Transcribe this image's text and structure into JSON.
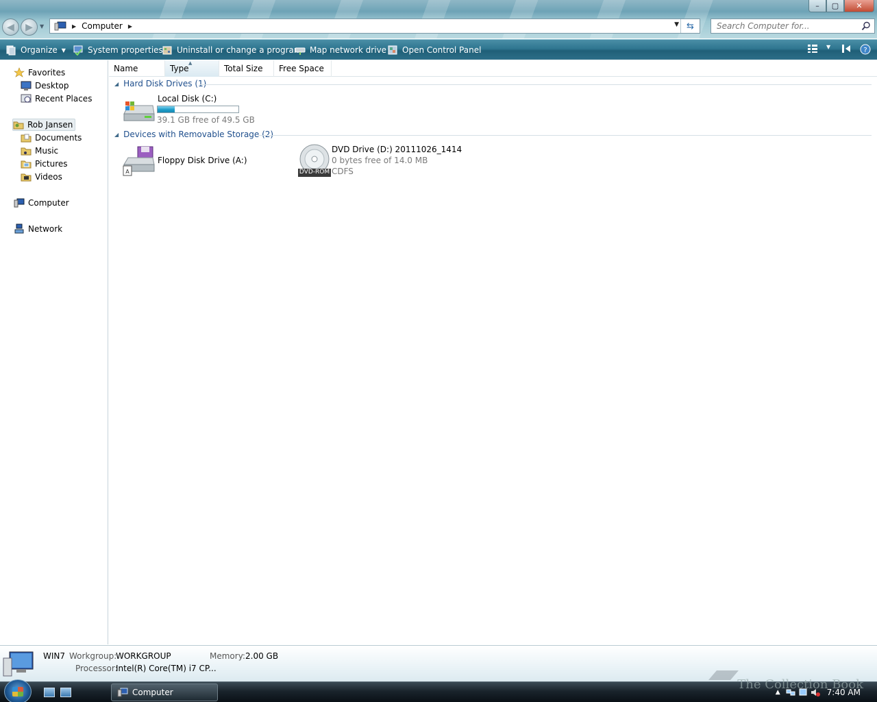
{
  "window": {
    "minimize": "–",
    "maximize": "▢",
    "close": "✕"
  },
  "address": {
    "location": "Computer",
    "refresh_icon": "refresh-icon"
  },
  "search": {
    "placeholder": "Search Computer for..."
  },
  "commandbar": {
    "organize": "Organize",
    "system_properties": "System properties",
    "uninstall": "Uninstall or change a program",
    "map_drive": "Map network drive",
    "control_panel": "Open Control Panel"
  },
  "navpane": {
    "favorites": "Favorites",
    "desktop": "Desktop",
    "recent": "Recent Places",
    "user": "Rob Jansen",
    "documents": "Documents",
    "music": "Music",
    "pictures": "Pictures",
    "videos": "Videos",
    "computer": "Computer",
    "network": "Network"
  },
  "columns": {
    "name": "Name",
    "type": "Type",
    "total_size": "Total Size",
    "free_space": "Free Space"
  },
  "groups": {
    "hard_disks": "Hard Disk Drives (1)",
    "removable": "Devices with Removable Storage (2)"
  },
  "drives": {
    "c": {
      "label": "Local Disk (C:)",
      "free_text": "39.1 GB free of 49.5 GB",
      "used_fraction": 0.21
    },
    "a": {
      "label": "Floppy Disk Drive (A:)"
    },
    "d": {
      "label": "DVD Drive (D:) 20111026_1414",
      "free_text": "0 bytes free of 14.0 MB",
      "fs": "CDFS",
      "badge": "DVD-ROM"
    }
  },
  "details": {
    "name": "WIN7",
    "workgroup_label": "Workgroup:",
    "workgroup": "WORKGROUP",
    "memory_label": "Memory:",
    "memory": "2.00 GB",
    "processor_label": "Processor:",
    "processor": "Intel(R) Core(TM) i7 CP..."
  },
  "watermark": "The Collection Book",
  "taskbar": {
    "window_button": "Computer",
    "clock": "7:40 AM"
  },
  "colors": {
    "accent": "#2f7690",
    "group_text": "#1e4e8c",
    "capacity_fill": "#1e9cc8"
  }
}
